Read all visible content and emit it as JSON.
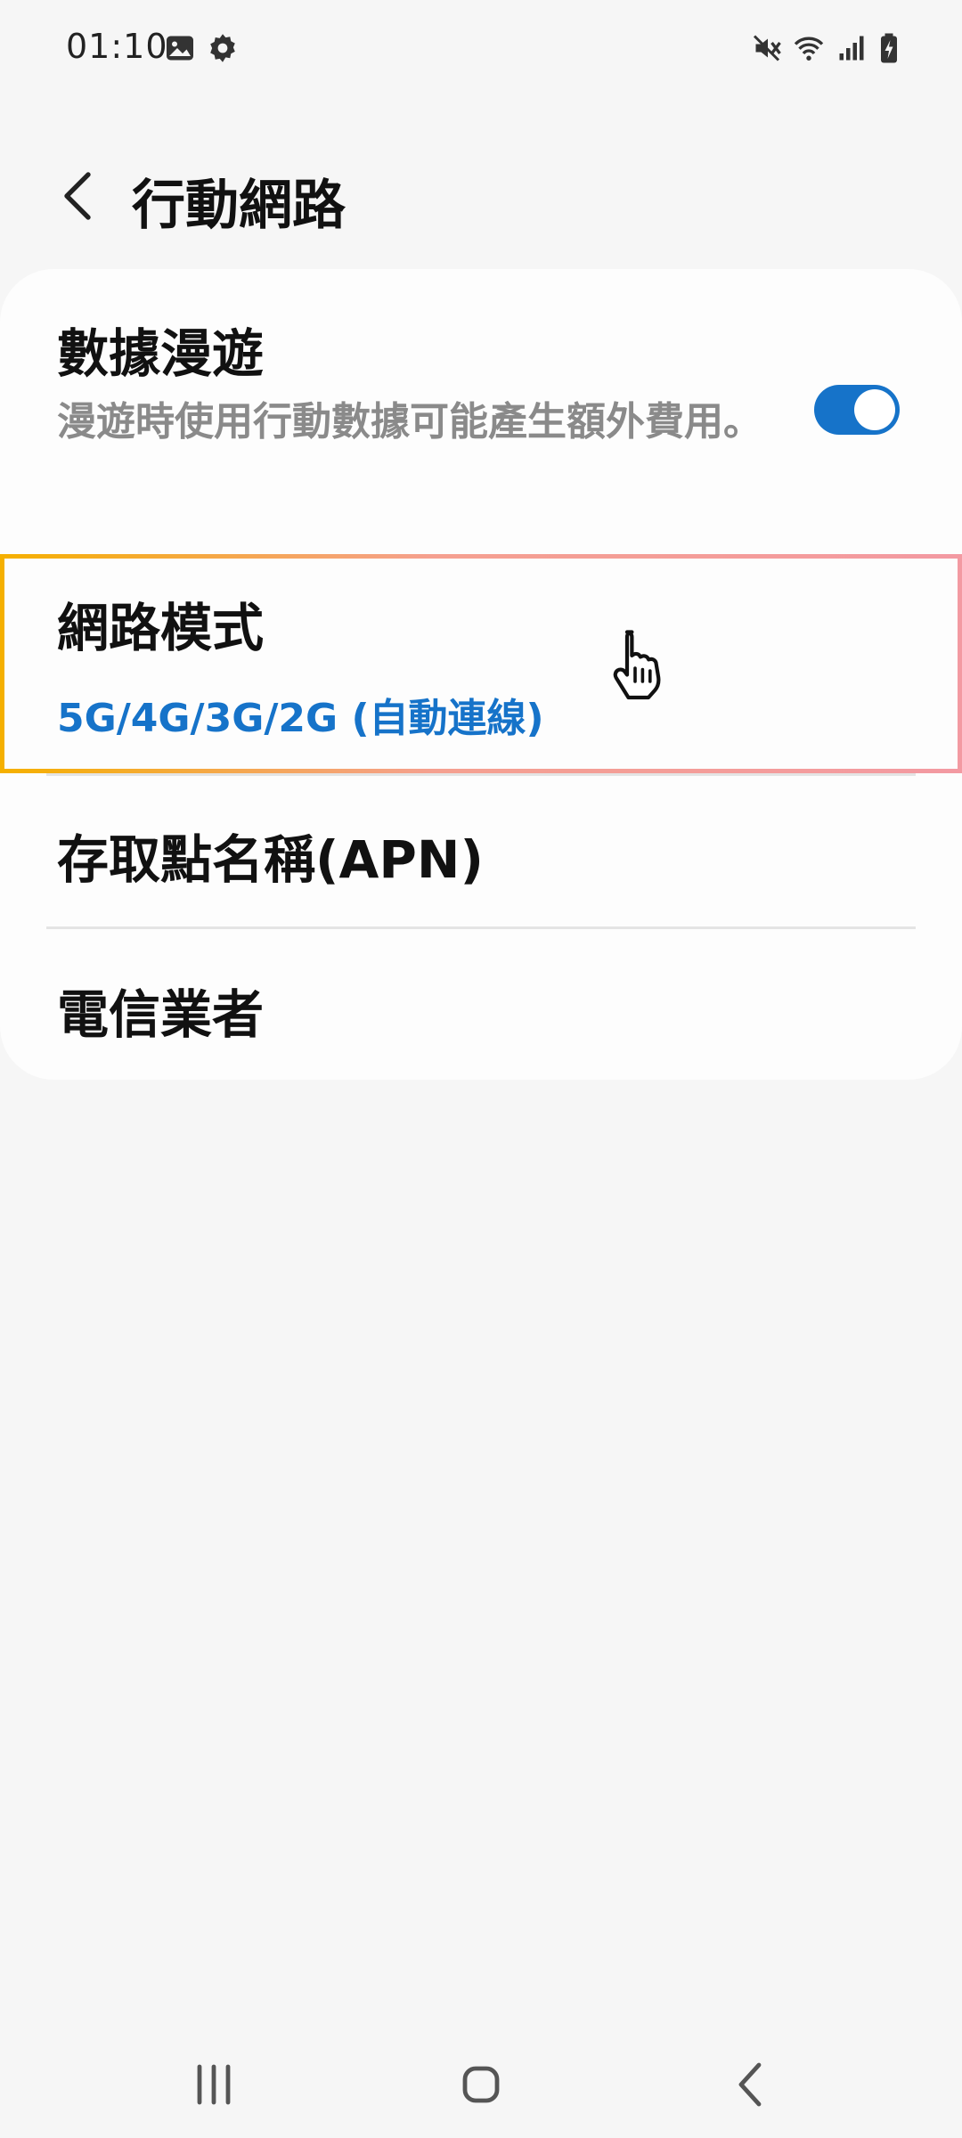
{
  "status_bar": {
    "time": "01:10",
    "icons": [
      "gallery-icon",
      "gear-icon",
      "mute-icon",
      "wifi-icon",
      "signal-icon",
      "battery-charging-icon"
    ]
  },
  "header": {
    "title": "行動網路",
    "back_icon": "chevron-left-icon"
  },
  "settings": {
    "data_roaming": {
      "title": "數據漫遊",
      "description": "漫遊時使用行動數據可能產生額外費用。",
      "enabled": true
    },
    "network_mode": {
      "title": "網路模式",
      "value": "5G/4G/3G/2G (自動連線)"
    },
    "apn": {
      "title": "存取點名稱(APN)"
    },
    "carrier": {
      "title": "電信業者"
    }
  },
  "nav_bar": {
    "buttons": [
      "recents-icon",
      "home-icon",
      "back-icon"
    ]
  },
  "colors": {
    "accent": "#1673c9",
    "background": "#f6f6f6",
    "card": "#fdfdfd"
  }
}
